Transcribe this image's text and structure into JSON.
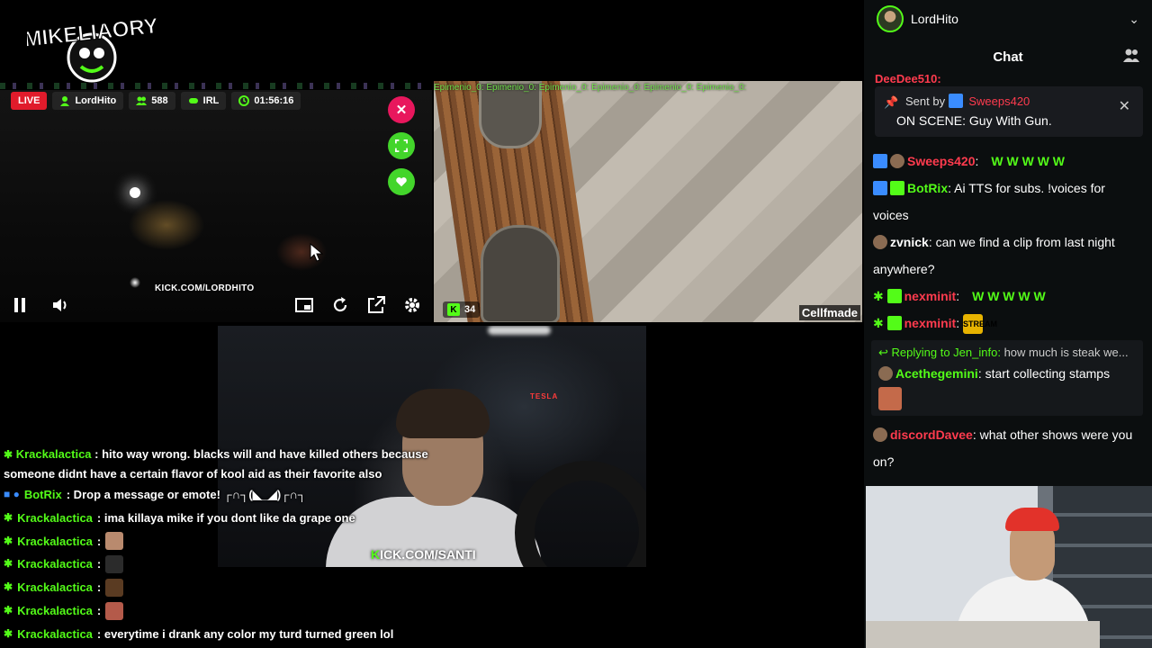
{
  "logo": {
    "text": "MIKELIAORY"
  },
  "stream_bar": {
    "live": "LIVE",
    "streamer": "LordHito",
    "viewers": "588",
    "category": "IRL",
    "uptime": "01:56:16"
  },
  "cam1": {
    "watermark": "KICK.COM/LORDHITO"
  },
  "cam2": {
    "ribbon": "Epimenio_0:  Epimenio_0:  Epimenio_0:  Epimenio_0:  Epimenio_0:  Epimenio_0:",
    "viewer_count": "34",
    "credit": "Cellfmade"
  },
  "cam3": {
    "tesla": "TESLA",
    "url_k": "K",
    "url_rest": "ICK.COM/SANTI"
  },
  "overlay_chat": [
    {
      "name": "Krackalactica",
      "text": ": hito way wrong. blacks will and have killed others because someone didnt have a certain flavor of kool aid as their favorite also"
    },
    {
      "name": "BotRix",
      "text": ": Drop a message or emote! ┌∩┐(◣_◢)┌∩┐"
    },
    {
      "name": "Krackalactica",
      "text": ": ima killaya mike if you dont like da grape one"
    },
    {
      "name": "Krackalactica",
      "text": ":"
    },
    {
      "name": "Krackalactica",
      "text": ":"
    },
    {
      "name": "Krackalactica",
      "text": ":"
    },
    {
      "name": "Krackalactica",
      "text": ":"
    },
    {
      "name": "Krackalactica",
      "text": ": everytime i drank any color my turd turned green lol"
    }
  ],
  "emote_colors": [
    "#b98a6e",
    "#2b2b2b",
    "#5a3b22",
    "#b45a4a"
  ],
  "chat_panel": {
    "user": "LordHito",
    "title": "Chat",
    "peek_name": "DeeDee510:",
    "pinned": {
      "sent_by": "Sent by",
      "sender": "Sweeps420",
      "message": "ON SCENE: Guy With Gun."
    },
    "messages": {
      "m1_user": "Sweeps420",
      "m1_text": "W  W  W  W  W",
      "m2_user": "BotRix",
      "m2_text": "Ai TTS for subs. !voices for voices",
      "m3_user": "zvnick",
      "m3_text": "can we find a clip from last night anywhere?",
      "m4_user": "nexminit",
      "m4_text": "W  W  W  W  W",
      "m5_user": "nexminit",
      "m5_emote": "STREAM",
      "reply_label": "Replying to Jen_info:",
      "reply_text": "how much is steak we...",
      "m6_user": "Acethegemini",
      "m6_text": "start collecting stamps",
      "m7_user": "discordDavee",
      "m7_text": "what other shows were you on?"
    }
  },
  "colors": {
    "kick_green": "#53fc18",
    "live_red": "#e01b2b",
    "close_pink": "#e8175d"
  }
}
